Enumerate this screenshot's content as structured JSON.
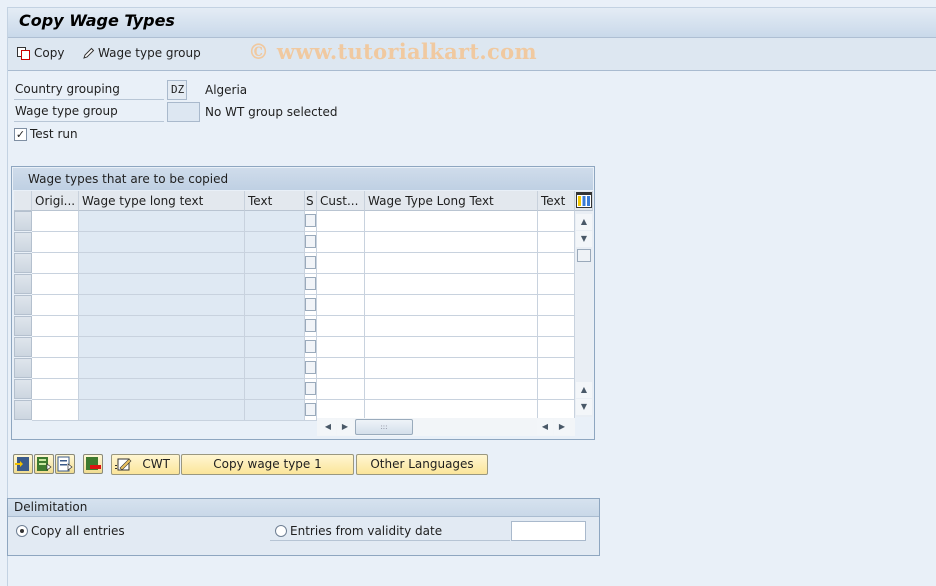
{
  "window": {
    "title": "Copy Wage Types"
  },
  "toolbar": {
    "copy_label": "Copy",
    "wage_type_group_label": "Wage type group",
    "watermark": "© www.tutorialkart.com"
  },
  "form": {
    "country_grouping": {
      "label": "Country grouping",
      "value": "DZ",
      "description": "Algeria"
    },
    "wage_type_group": {
      "label": "Wage type group",
      "value": "",
      "description": "No WT group selected"
    },
    "test_run": {
      "label": "Test run",
      "checked": true
    }
  },
  "table": {
    "title": "Wage types that are to be copied",
    "columns": [
      "Origi...",
      "Wage type long text",
      "Text",
      "S",
      "Cust...",
      "Wage Type Long Text",
      "Text"
    ],
    "row_count": 10,
    "rows": []
  },
  "actions": {
    "icons": [
      "insert-row-icon",
      "select-all-icon",
      "deselect-all-icon",
      "delete-row-icon"
    ],
    "cwt_label": "CWT",
    "copy_wage_type_label": "Copy wage type 1",
    "other_languages_label": "Other Languages"
  },
  "delimitation": {
    "title": "Delimitation",
    "copy_all_label": "Copy all entries",
    "copy_all_selected": true,
    "from_date_label": "Entries from validity date",
    "from_date_selected": false,
    "from_date_value": ""
  }
}
